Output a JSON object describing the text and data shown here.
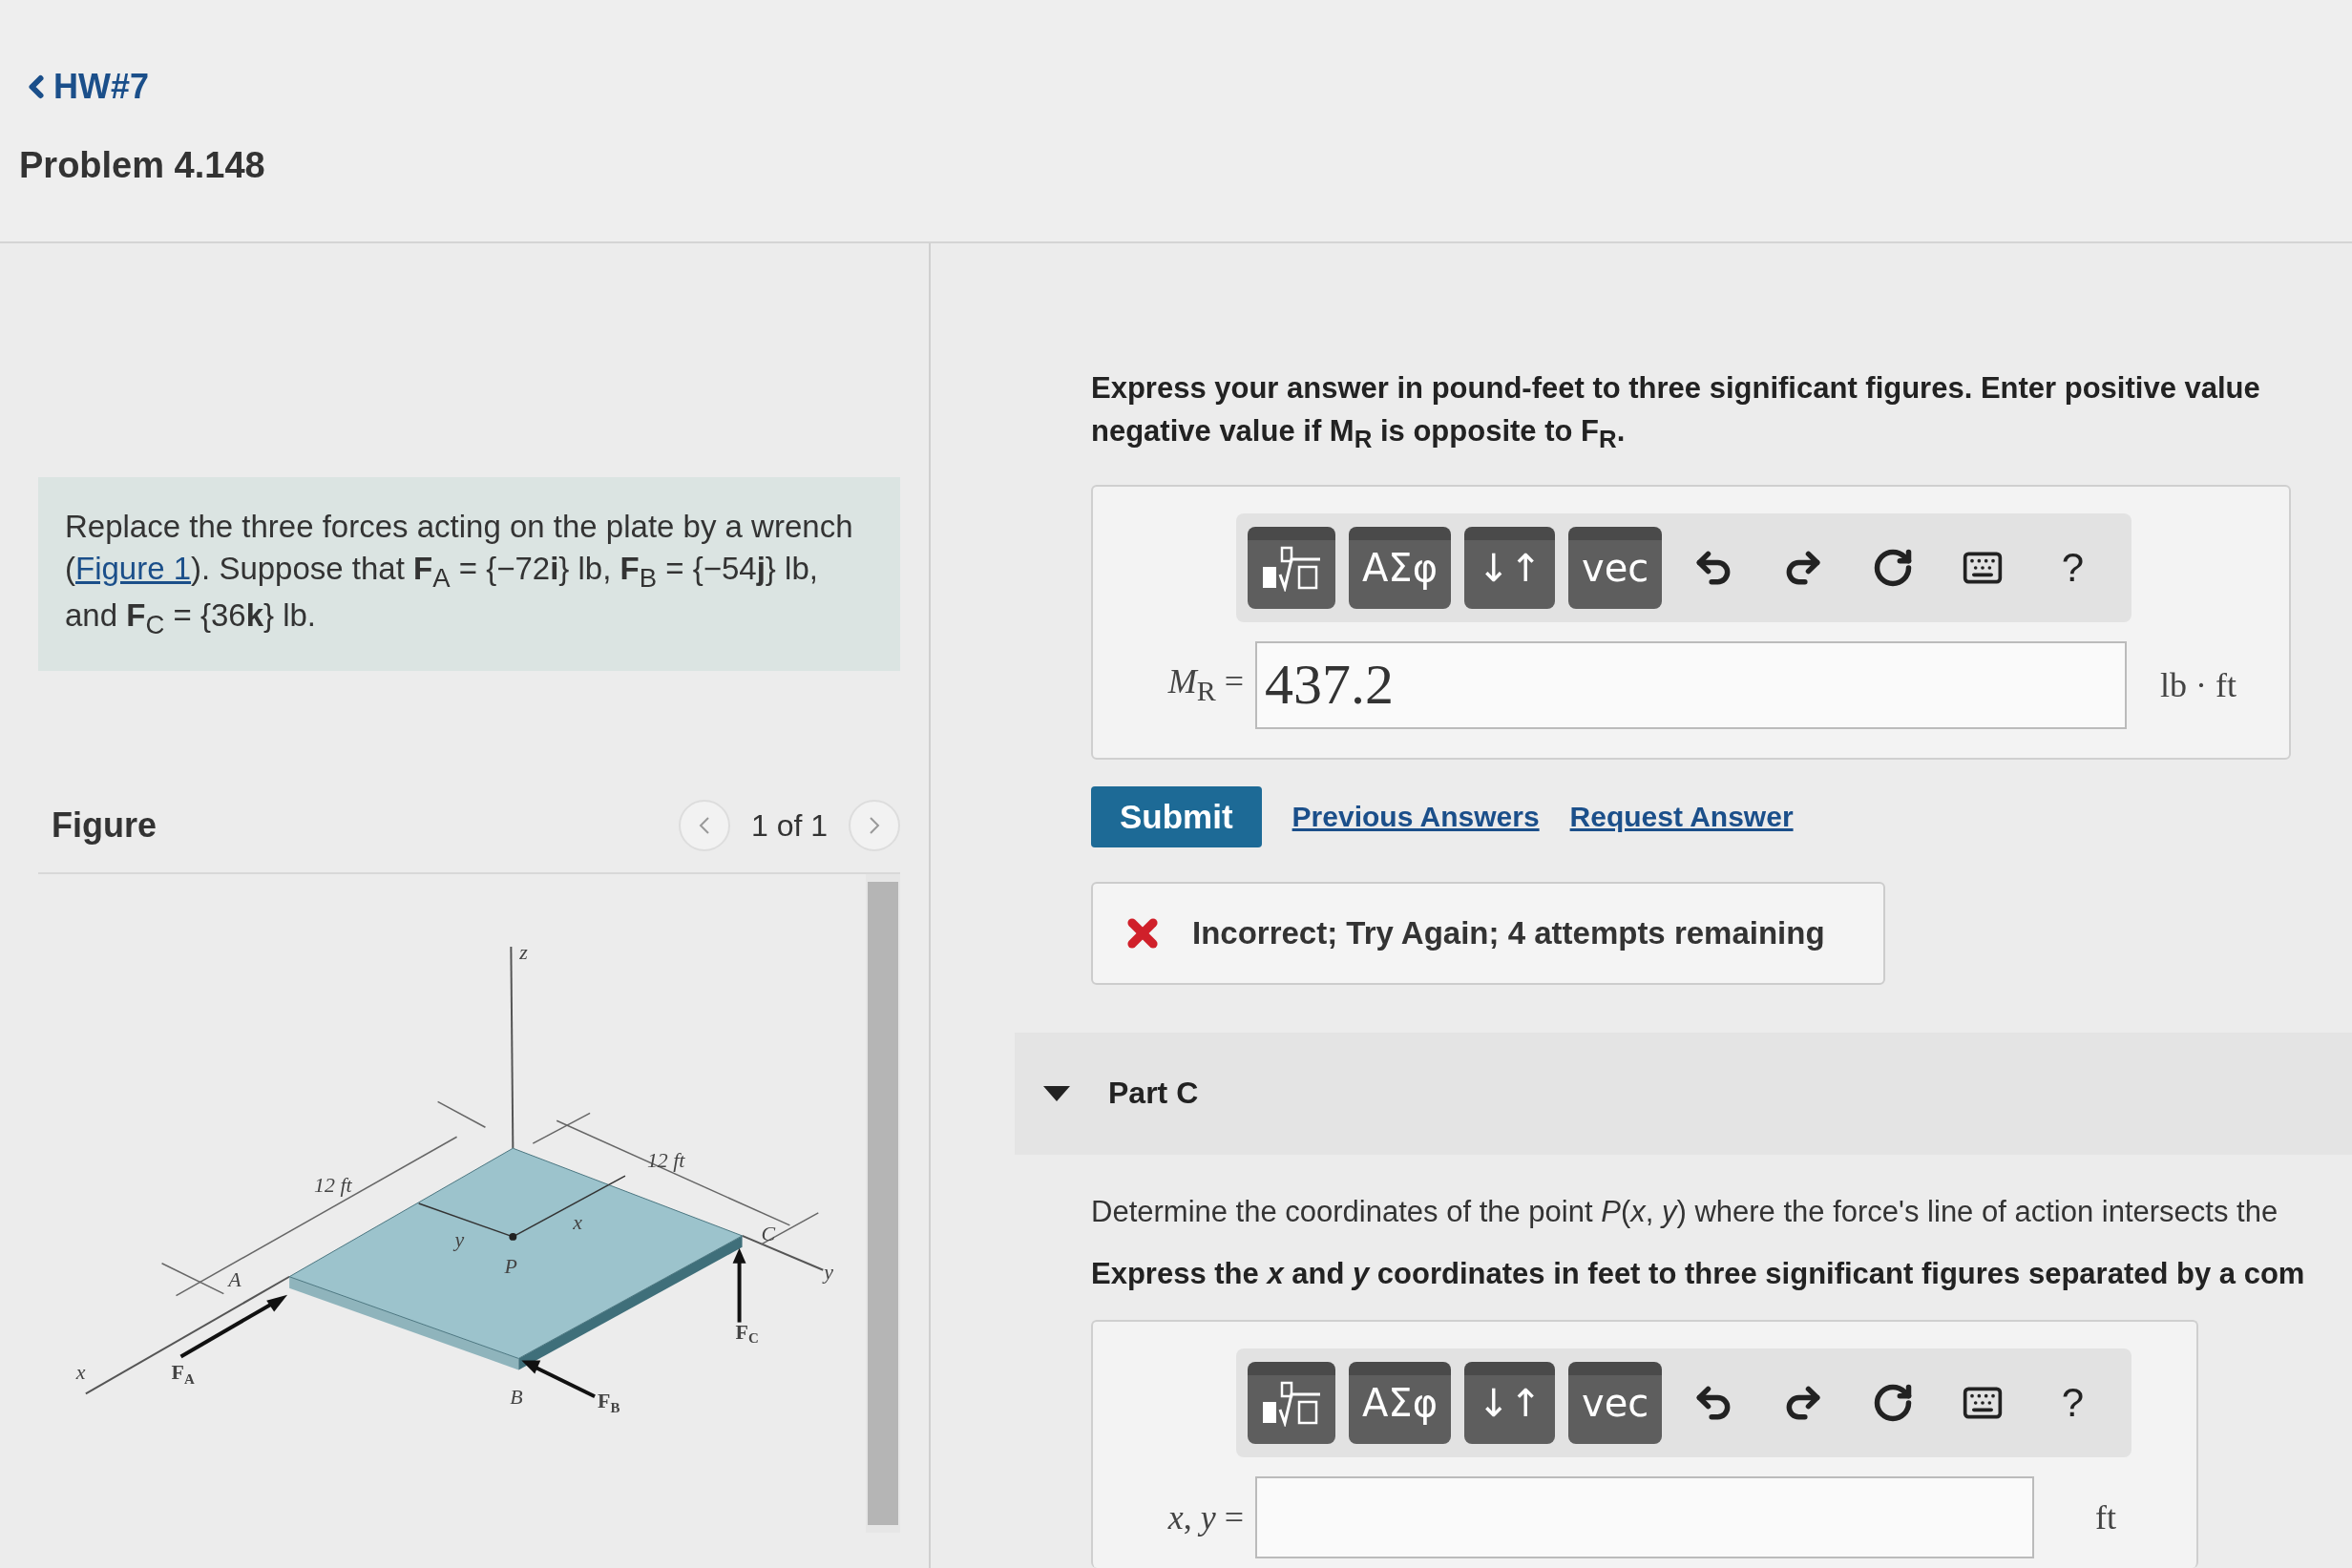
{
  "header": {
    "back_link": "HW#7",
    "title": "Problem 4.148"
  },
  "statement": {
    "before": "Replace the three forces acting on the plate by a wrench (",
    "link": "Figure 1",
    "after": "). Suppose that **F**$_{A}$ = {−72**i**} lb, **F**$_{B}$ = {−54**j**} lb, and **F**$_{C}$ = {36**k**} lb."
  },
  "figure": {
    "title": "Figure",
    "pager": "1 of 1",
    "labels": [
      "z",
      "12 ft",
      "12 ft",
      "y",
      "x",
      "P",
      "A",
      "C",
      "y",
      "x",
      "B",
      "F$_{A}$",
      "F$_{B}$",
      "F$_{C}$"
    ]
  },
  "part_b": {
    "instruction_lines": [
      "Express your answer in pound-feet to three significant figures. Enter positive value",
      "negative value if **M**$_{R}$ is opposite to **F**$_{R}$."
    ],
    "toolbar": [
      {
        "kind": "templates"
      },
      {
        "kind": "text",
        "label": "ΑΣφ"
      },
      {
        "kind": "text",
        "label": "↓↑"
      },
      {
        "kind": "text",
        "label": "vec"
      },
      {
        "kind": "undo"
      },
      {
        "kind": "redo"
      },
      {
        "kind": "reset"
      },
      {
        "kind": "keyboard"
      },
      {
        "kind": "help",
        "label": "?"
      }
    ],
    "answer_label": "*M*$_{R}$ =",
    "answer_value": "437.2",
    "unit": "lb · ft",
    "submit": "Submit",
    "links": [
      "Previous Answers",
      "Request Answer"
    ],
    "feedback": {
      "correct": false,
      "text": "Incorrect; Try Again; 4 attempts remaining"
    }
  },
  "part_c": {
    "title": "Part C",
    "expanded": true,
    "question": "Determine the coordinates of the point *P*(*x*, *y*) where the force's line of action intersects the",
    "instruction": "Express the *x* and *y* coordinates in feet to three significant figures separated by a com",
    "toolbar": [
      {
        "kind": "templates"
      },
      {
        "kind": "text",
        "label": "ΑΣφ"
      },
      {
        "kind": "text",
        "label": "↓↑"
      },
      {
        "kind": "text",
        "label": "vec"
      },
      {
        "kind": "undo"
      },
      {
        "kind": "redo"
      },
      {
        "kind": "reset"
      },
      {
        "kind": "keyboard"
      },
      {
        "kind": "help",
        "label": "?"
      }
    ],
    "answer_label": "*x*, *y* =",
    "unit": "ft"
  }
}
